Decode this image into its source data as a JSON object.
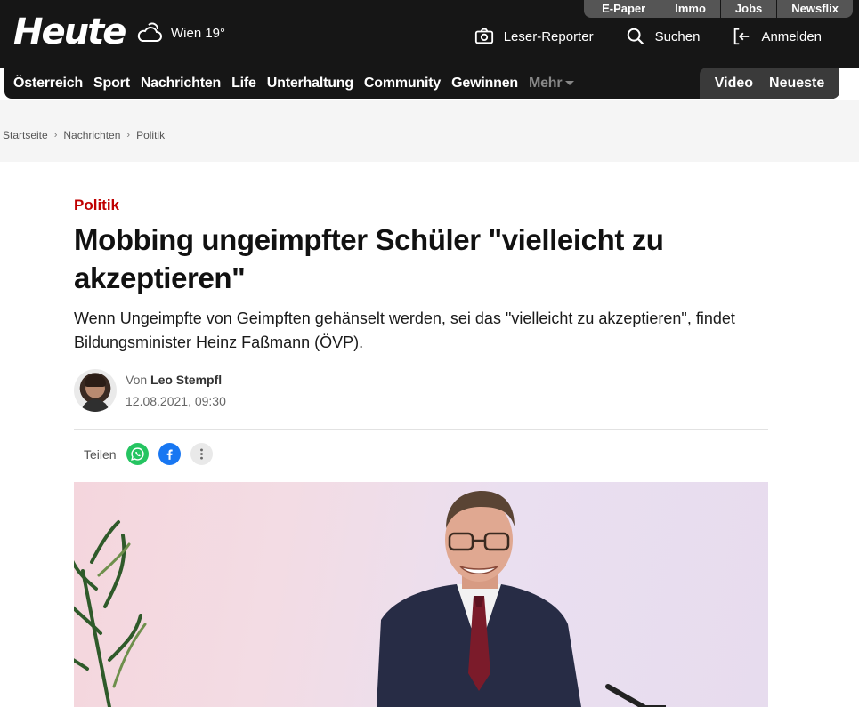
{
  "header": {
    "logo": "Heute",
    "weather": "Wien 19°",
    "toplinks": [
      "E-Paper",
      "Immo",
      "Jobs",
      "Newsflix"
    ],
    "actions": {
      "reporter": "Leser-Reporter",
      "search": "Suchen",
      "login": "Anmelden"
    }
  },
  "nav": {
    "items": [
      "Österreich",
      "Sport",
      "Nachrichten",
      "Life",
      "Unterhaltung",
      "Community",
      "Gewinnen"
    ],
    "more": "Mehr",
    "right": [
      "Video",
      "Neueste"
    ]
  },
  "breadcrumb": [
    "Startseite",
    "Nachrichten",
    "Politik"
  ],
  "article": {
    "kicker": "Politik",
    "headline": "Mobbing ungeimpfter Schüler \"vielleicht zu akzeptieren\"",
    "lead": "Wenn Ungeimpfte von Geimpften gehänselt werden, sei das \"vielleicht zu akzeptieren\", findet Bildungsminister Heinz Faßmann (ÖVP).",
    "author_prefix": "Von",
    "author": "Leo Stempfl",
    "date": "12.08.2021, 09:30",
    "share_label": "Teilen"
  },
  "colors": {
    "accent": "#c00000",
    "topbar": "#161616",
    "whatsapp": "#25c461",
    "facebook": "#1877f2"
  }
}
